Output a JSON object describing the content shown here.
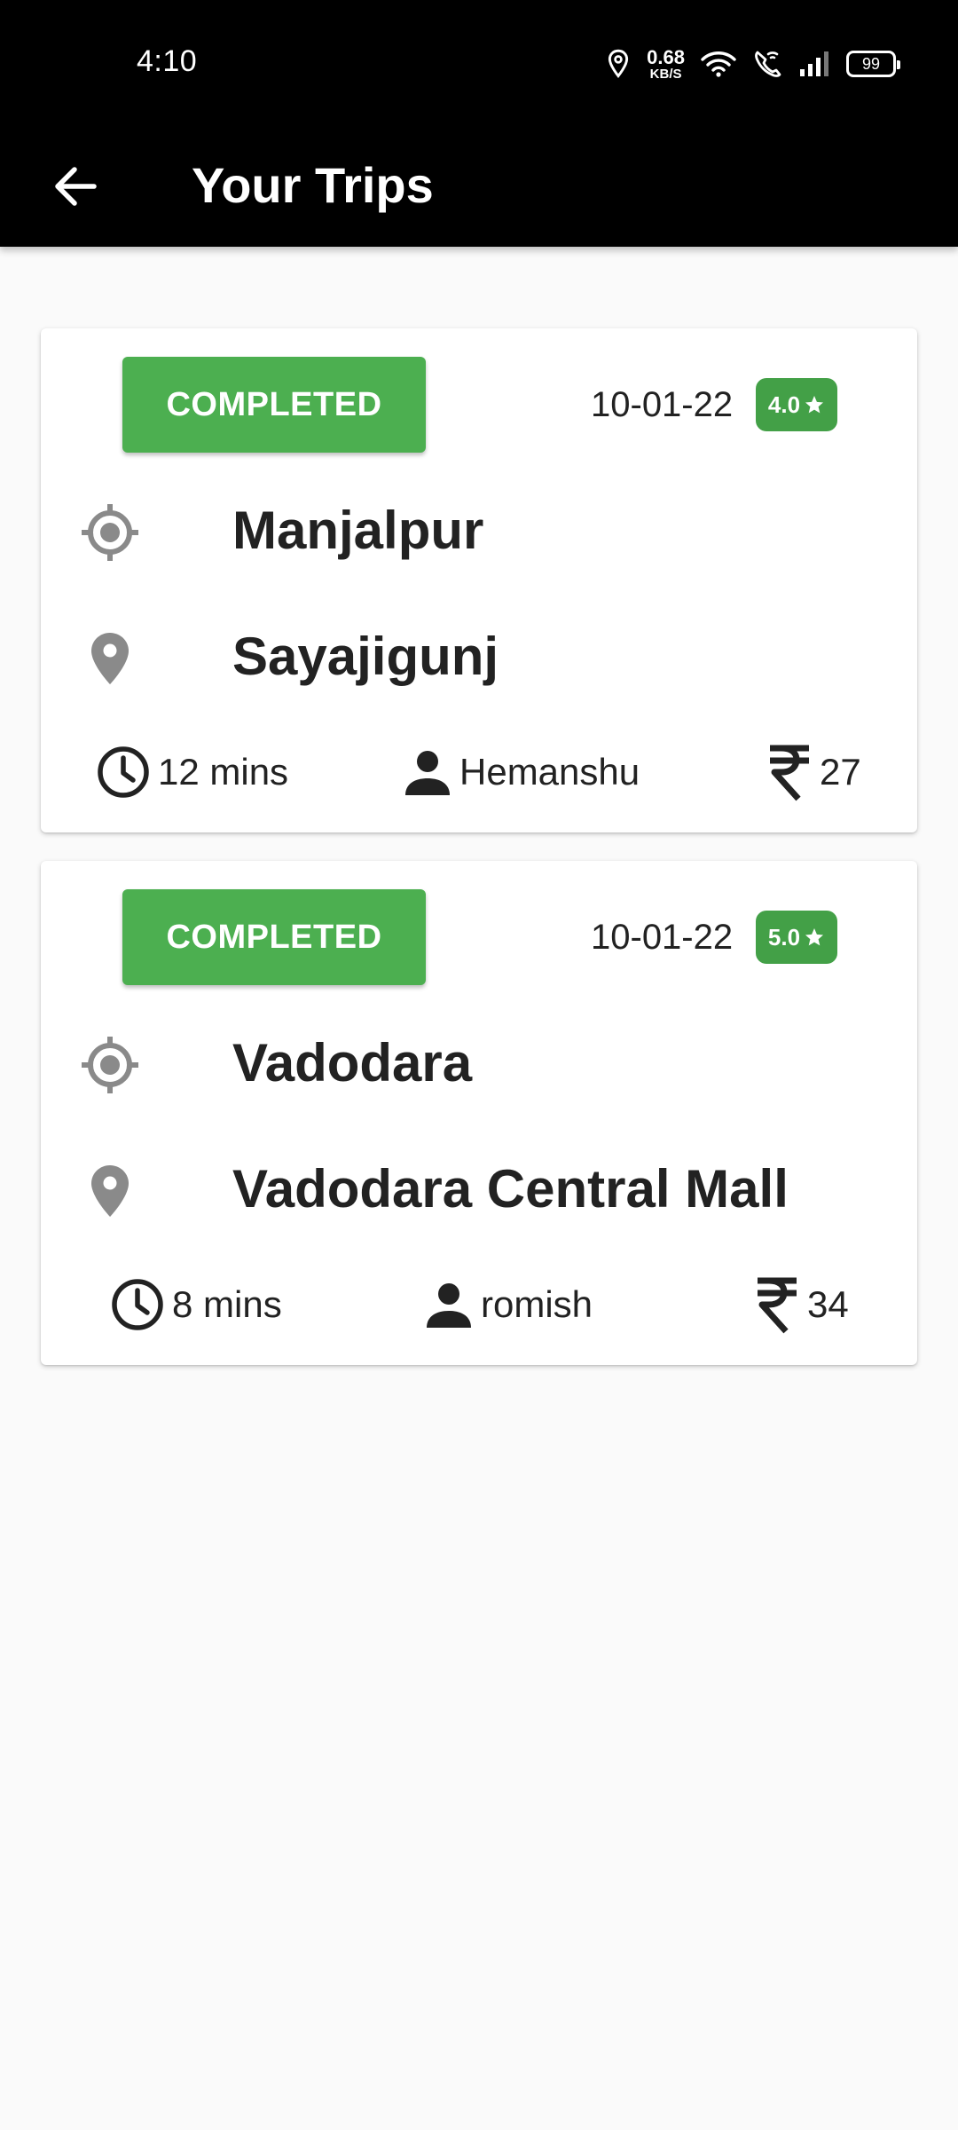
{
  "status_bar": {
    "time": "4:10",
    "net_speed_value": "0.68",
    "net_speed_unit": "KB/S",
    "battery": "99",
    "icons": [
      "location-icon",
      "wifi-icon",
      "wifi-calling-icon",
      "signal-icon",
      "battery-icon"
    ]
  },
  "app_bar": {
    "back_icon": "arrow-left-icon",
    "title": "Your Trips"
  },
  "colors": {
    "status_chip": "#4caf50",
    "rating_badge": "#43a047",
    "location_icon": "#8a8a8a"
  },
  "trips": [
    {
      "status": "COMPLETED",
      "date": "10-01-22",
      "rating": "4.0",
      "pickup": "Manjalpur",
      "drop": "Sayajigunj",
      "duration": "12 mins",
      "driver": "Hemanshu",
      "fare": "27"
    },
    {
      "status": "COMPLETED",
      "date": "10-01-22",
      "rating": "5.0",
      "pickup": "Vadodara",
      "drop": "Vadodara Central Mall",
      "duration": "8 mins",
      "driver": "romish",
      "fare": "34"
    }
  ]
}
